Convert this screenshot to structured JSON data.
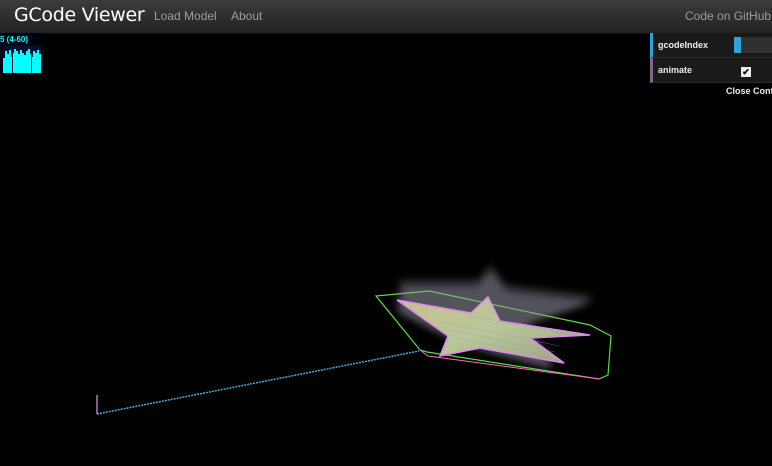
{
  "navbar": {
    "brand": "GCode Viewer",
    "links": [
      "Load Model",
      "About"
    ],
    "github": "Code on GitHub"
  },
  "stats": {
    "fps_label": "5 (4-60)",
    "bars": [
      0.55,
      0.8,
      0.7,
      0.85,
      0.6,
      0.75,
      0.9,
      0.8,
      0.7,
      0.85,
      0.75,
      0.65,
      0.8,
      0.9,
      0.7,
      0.6,
      0.8,
      0.75,
      0.85,
      0.7
    ]
  },
  "gui": {
    "gcode_label": "gcodeIndex",
    "gcode_fill": 0.17,
    "animate_label": "animate",
    "animate_checked": true,
    "close_label": "Close Controls"
  },
  "colors": {
    "accent_blue": "#2fa1d6",
    "accent_purple": "#806787",
    "bed_outline": "#5bdc3d",
    "travel_line": "#4aa8d8"
  }
}
